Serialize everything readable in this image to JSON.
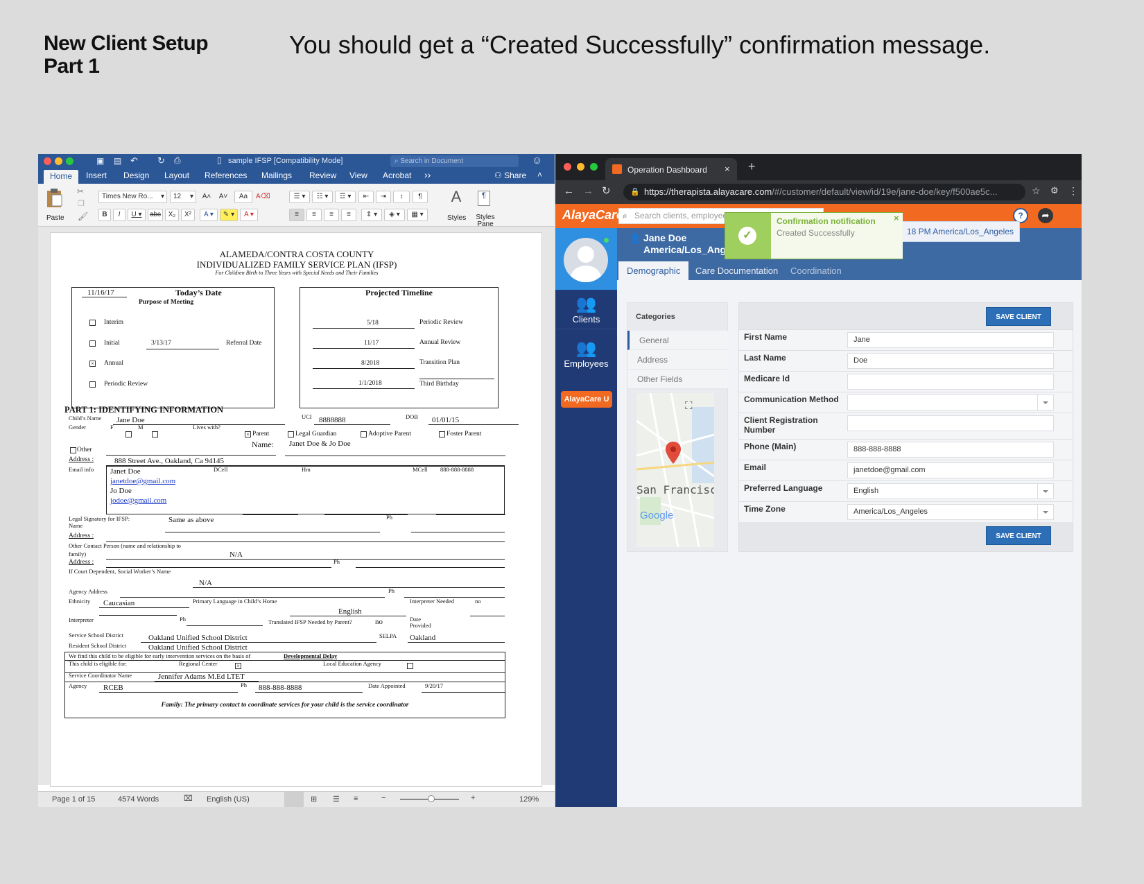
{
  "slide": {
    "title": "New Client Setup\nPart 1",
    "subtitle": "You should get a “Created Successfully” confirmation message."
  },
  "word": {
    "window_title": "sample IFSP [Compatibility Mode]",
    "search_placeholder": "Search in Document",
    "tabs": [
      "Home",
      "Insert",
      "Design",
      "Layout",
      "References",
      "Mailings",
      "Review",
      "View",
      "Acrobat"
    ],
    "share_label": "Share",
    "paste_label": "Paste",
    "font_name": "Times New Ro...",
    "font_size": "12",
    "styles_label": "Styles",
    "styles_pane_label": "Styles Pane",
    "status": {
      "page": "Page 1 of 15",
      "words": "4574 Words",
      "language": "English (US)",
      "zoom": "129%"
    },
    "doc": {
      "header1": "ALAMEDA/CONTRA COSTA COUNTY",
      "header2": "INDIVIDUALIZED FAMILY SERVICE PLAN (IFSP)",
      "header3": "For Children Birth to Three Years with Special Needs and Their Families",
      "todays_date_value": "11/16/17",
      "todays_date_label": "Today’s Date",
      "purpose_label": "Purpose of Meeting",
      "opt_interim": "Interim",
      "opt_initial": "Initial",
      "initial_date": "3/13/17",
      "referral_label": "Referral Date",
      "opt_annual": "Annual",
      "opt_periodic": "Periodic Review",
      "timeline_title": "Projected Timeline",
      "timeline": [
        {
          "date": "5/18",
          "label": "Periodic Review"
        },
        {
          "date": "11/17",
          "label": "Annual Review"
        },
        {
          "date": "8/2018",
          "label": "Transition Plan"
        },
        {
          "date": "1/1/2018",
          "label": "Third Birthday"
        }
      ],
      "part1_title": "PART 1:  IDENTIFYING INFORMATION",
      "child_name_label": "Child’s Name",
      "child_name": "Jane Doe",
      "uci_label": "UCI",
      "uci": "8888888",
      "dob_label": "DOB",
      "dob": "01/01/15",
      "gender_label": "Gender",
      "gender_f": "F",
      "gender_m": "M",
      "lives_with": "Lives with?",
      "parent": "Parent",
      "legal_guardian": "Legal Guardian",
      "adoptive_parent": "Adoptive Parent",
      "foster_parent": "Foster Parent",
      "name_label": "Name:",
      "parents_name": "Janet Doe & Jo Doe",
      "other_label": "Other",
      "address_label": "Address :",
      "address": "888 Street Ave., Oakland, Ca 94145",
      "email_info_label": "Email info",
      "contact1": "Janet Doe",
      "email1": "janetdoe@gmail.com",
      "contact2": "Jo Doe",
      "email2": "jodoe@gmail.com",
      "dcell": "DCell",
      "hm": "Hm",
      "mcell": "MCell",
      "mcell_value": "888-888-8888",
      "legal_sig_label": "Legal Signatory for IFSP:",
      "legal_sig_name_label": "Name",
      "legal_sig": "Same as above",
      "ph": "Ph",
      "other_contact_label": "Other Contact Person (name and relationship to",
      "other_contact_label2": "family)",
      "other_contact": "N/A",
      "court_label": "If Court Dependent, Social Worker’s Name",
      "court": "N/A",
      "agency_address_label": "Agency Address",
      "ethnicity_label": "Ethnicity",
      "ethnicity": "Caucasian",
      "primary_lang_label": "Primary Language in Child’s Home",
      "primary_lang": "English",
      "interp_needed_label": "Interpreter Needed",
      "interp_needed": "no",
      "interpreter_label": "Interpreter",
      "translated_label": "Translated IFSP Needed by Parent?",
      "translated": "no",
      "date_provided_label": "Date Provided",
      "service_sd_label": "Service School District",
      "service_sd": "Oakland Unified School District",
      "resident_sd_label": "Resident School District",
      "resident_sd": "Oakland Unified School District",
      "selpa_label": "SELPA",
      "selpa": "Oakland",
      "eligible_text": "We find this child to be eligible for early intervention services on the basis of",
      "eligible_basis": "Developmental Delay",
      "eligible_for": "This child is eligible for:",
      "regional_center": "Regional Center",
      "local_ed": "Local Education Agency",
      "coord_label": "Service Coordinator Name",
      "coord": "Jennifer Adams M.Ed LTET",
      "agency_label": "Agency",
      "agency": "RCEB",
      "agency_ph": "888-888-8888",
      "date_appointed_label": "Date Appointed",
      "date_appointed": "9/20/17",
      "footer": "Family:  The primary contact to coordinate services for your child is the service coordinator"
    }
  },
  "browser": {
    "tab_title": "Operation Dashboard",
    "url_host": "https://therapista.alayacare.com",
    "url_path": "/#/customer/default/view/id/19e/jane-doe/key/f500ae5c...",
    "logo": "AlayaCare",
    "search_placeholder": "Search clients, employees, contacts",
    "nav_clients": "Clients",
    "nav_employees": "Employees",
    "alayacare_u": "AlayaCare U",
    "client_name": "Jane Doe",
    "client_tz": "America/Los_Angeles",
    "tz_strip": "18 PM  America/Los_Angeles",
    "tabs": [
      "Demographic",
      "Care Documentation",
      "Coordination"
    ],
    "categories_title": "Categories",
    "categories": [
      "General",
      "Address",
      "Other Fields"
    ],
    "map_label": "San Francisco",
    "map_google": "Google",
    "save_label": "SAVE CLIENT",
    "toast_title": "Confirmation notification",
    "toast_message": "Created Successfully",
    "fields": [
      {
        "label": "First Name",
        "value": ""
      },
      {
        "label": "Last Name",
        "value": ""
      },
      {
        "label": "Medicare Id",
        "value": ""
      },
      {
        "label": "Communication Method",
        "value": ""
      },
      {
        "label": "Client Registration Number",
        "value": ""
      },
      {
        "label": "Phone (Main)",
        "value": ""
      },
      {
        "label": "Email",
        "value": ""
      },
      {
        "label": "Preferred Language",
        "value": ""
      },
      {
        "label": "Time Zone",
        "value": ""
      }
    ],
    "values": {
      "first_name": "Jane",
      "last_name": "Doe",
      "medicare_id": "",
      "communication_method": "",
      "registration_number": "",
      "phone": "888-888-8888",
      "email": "janetdoe@gmail.com",
      "language": "English",
      "timezone": "America/Los_Angeles"
    },
    "colors": {
      "orange": "#f26a22",
      "navy": "#1f3a74",
      "blue": "#3e6aa3",
      "toast_green": "#9fcf5f"
    }
  }
}
